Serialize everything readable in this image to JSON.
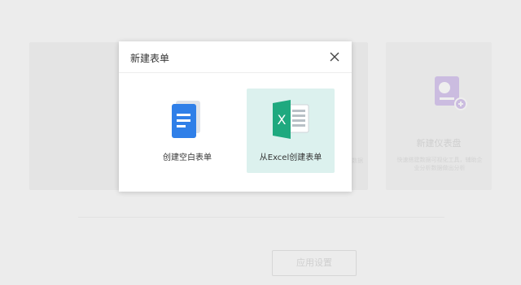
{
  "background": {
    "card_title": "新建仪表盘",
    "card_desc": "快速搭建数据可视化工具，辅助企业分析数据做出分析",
    "mid_desc": "数据",
    "settings_button": "应用设置"
  },
  "modal": {
    "title": "新建表单",
    "options": [
      {
        "label": "创建空白表单",
        "icon": "blank-form-icon"
      },
      {
        "label": "从Excel创建表单",
        "icon": "excel-icon"
      }
    ]
  },
  "colors": {
    "selected_bg": "#dcf1ee",
    "doc_blue": "#2f7fe8",
    "excel_green": "#1fa97f"
  }
}
